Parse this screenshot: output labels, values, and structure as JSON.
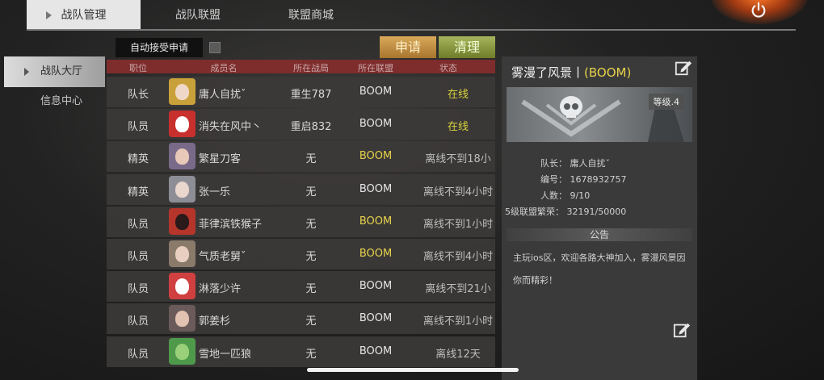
{
  "top_tabs": [
    "战队管理",
    "战队联盟",
    "联盟商城"
  ],
  "side_menu": [
    "战队大厅",
    "信息中心"
  ],
  "toolbar": {
    "auto_accept": "自动接受申请",
    "apply": "申请",
    "clean": "清理"
  },
  "columns": [
    "职位",
    "成员名",
    "所在战局",
    "所在联盟",
    "状态"
  ],
  "members": [
    {
      "role": "队长",
      "name": "庸人自扰ˇ",
      "game": "重生787",
      "alliance": "BOOM",
      "status": "在线",
      "alliance_color": "#e6e6e6",
      "status_color": "#d8d23a"
    },
    {
      "role": "队员",
      "name": "消失在风中丶",
      "game": "重启832",
      "alliance": "BOOM",
      "status": "在线",
      "alliance_color": "#e6e6e6",
      "status_color": "#d8d23a"
    },
    {
      "role": "精英",
      "name": "繁星刀客",
      "game": "无",
      "alliance": "BOOM",
      "status": "离线不到18小",
      "alliance_color": "#e8d34a",
      "status_color": "#bdbdbd"
    },
    {
      "role": "精英",
      "name": "张一乐",
      "game": "无",
      "alliance": "BOOM",
      "status": "离线不到4小时",
      "alliance_color": "#e6e6e6",
      "status_color": "#bdbdbd"
    },
    {
      "role": "队员",
      "name": "菲律滨铁猴子",
      "game": "无",
      "alliance": "BOOM",
      "status": "离线不到1小时",
      "alliance_color": "#e8d34a",
      "status_color": "#bdbdbd"
    },
    {
      "role": "队员",
      "name": "气质老舅ˇ",
      "game": "无",
      "alliance": "BOOM",
      "status": "离线不到4小时",
      "alliance_color": "#e8d34a",
      "status_color": "#bdbdbd"
    },
    {
      "role": "队员",
      "name": "淋落少许",
      "game": "无",
      "alliance": "BOOM",
      "status": "离线不到21小",
      "alliance_color": "#e6e6e6",
      "status_color": "#bdbdbd"
    },
    {
      "role": "队员",
      "name": "郭姜杉",
      "game": "无",
      "alliance": "BOOM",
      "status": "离线不到1小时",
      "alliance_color": "#e6e6e6",
      "status_color": "#bdbdbd"
    },
    {
      "role": "队员",
      "name": "雪地一匹狼",
      "game": "无",
      "alliance": "BOOM",
      "status": "离线12天",
      "alliance_color": "#e6e6e6",
      "status_color": "#bdbdbd"
    }
  ],
  "team": {
    "name": "雾漫了风景丨",
    "tag": "(BOOM)",
    "level": "等级.4",
    "captain_label": "队长：",
    "captain": "庸人自扰ˇ",
    "id_label": "编号：",
    "id": "1678932757",
    "count_label": "人数：",
    "count": "9/10",
    "prosperity_label": "5级联盟繁荣：",
    "prosperity": "32191/50000",
    "notice_title": "公告",
    "notice_line1": "主玩ios区，欢迎各路大神加入，雾漫风景因",
    "notice_line2": "你而精彩！"
  },
  "icons": [
    "power-icon",
    "edit-icon",
    "skull-emblem-icon"
  ]
}
